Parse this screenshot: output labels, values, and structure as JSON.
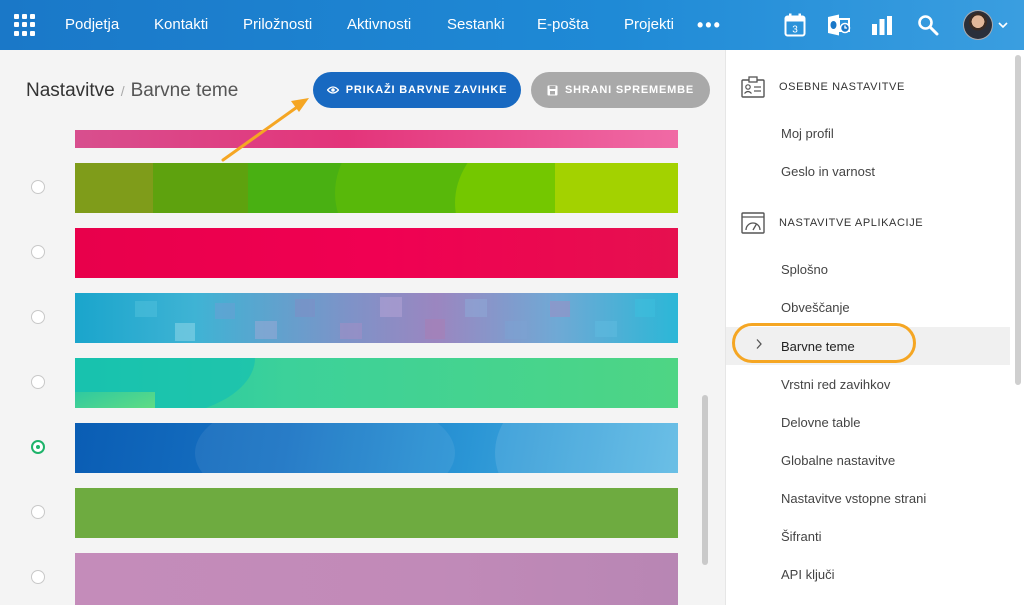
{
  "nav": {
    "items": [
      "Podjetja",
      "Kontakti",
      "Priložnosti",
      "Aktivnosti",
      "Sestanki",
      "E-pošta",
      "Projekti"
    ],
    "more": "•••",
    "calendar_day": "3"
  },
  "page": {
    "breadcrumb_root": "Nastavitve",
    "breadcrumb_separator": "/",
    "breadcrumb_current": "Barvne teme",
    "show_tabs_button": "PRIKAŽI BARVNE ZAVIHKE",
    "save_button": "SHRANI SPREMEMBE"
  },
  "themes": {
    "selected_index": 5,
    "rows": [
      {
        "name": "pink-gradient",
        "colors": [
          "#d84f8e",
          "#e3347a",
          "#f06aa5"
        ]
      },
      {
        "name": "green-lime",
        "colors": [
          "#7a9a17",
          "#3aaa13",
          "#a9d400"
        ]
      },
      {
        "name": "crimson",
        "colors": [
          "#e5004d",
          "#f0004f",
          "#e8124f"
        ]
      },
      {
        "name": "mosaic-blue-violet",
        "colors": [
          "#1aa5cc",
          "#8a8fc6",
          "#2bb7d7"
        ]
      },
      {
        "name": "teal-green",
        "colors": [
          "#1ac4a6",
          "#42d49a",
          "#4cd685"
        ]
      },
      {
        "name": "ocean-blue",
        "colors": [
          "#0a5fb7",
          "#1f7fcc",
          "#54b5e3"
        ]
      },
      {
        "name": "leaf-green",
        "colors": [
          "#6aaa3c",
          "#6eab40",
          "#72ad44"
        ]
      },
      {
        "name": "mauve",
        "colors": [
          "#c38bb9",
          "#c28ab8",
          "#b686b4"
        ]
      }
    ]
  },
  "sidebar": {
    "section_personal": "OSEBNE NASTAVITVE",
    "personal_items": [
      "Moj profil",
      "Geslo in varnost"
    ],
    "section_app": "NASTAVITVE APLIKACIJE",
    "app_items": [
      "Splošno",
      "Obveščanje",
      "Barvne teme",
      "Vrstni red zavihkov",
      "Delovne table",
      "Globalne nastavitve",
      "Nastavitve vstopne strani",
      "Šifranti",
      "API ključi"
    ],
    "active_item": "Barvne teme"
  },
  "colors": {
    "topbar": "#1a78c8",
    "primary_button": "#1869c1",
    "secondary_button": "#a9a9a9",
    "annotation": "#f5a623",
    "radio_checked": "#1eb36a"
  }
}
